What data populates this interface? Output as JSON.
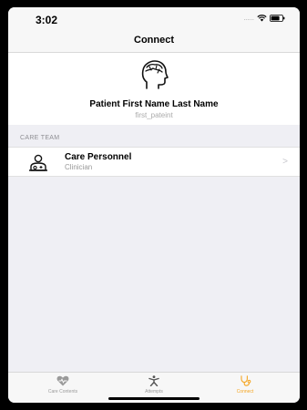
{
  "status_bar": {
    "time": "3:02",
    "signal": "......"
  },
  "nav": {
    "title": "Connect"
  },
  "profile": {
    "name": "Patient First Name Last Name",
    "username": "first_pateint",
    "avatar_icon": "head-brain-icon"
  },
  "care_team": {
    "section_label": "CARE TEAM",
    "items": [
      {
        "title": "Care Personnel",
        "subtitle": "Clinician",
        "icon": "clinician-icon",
        "chevron": ">"
      }
    ]
  },
  "tab_bar": {
    "tabs": [
      {
        "label": "Care Contents",
        "icon": "heart-icon",
        "active": false
      },
      {
        "label": "Attempts",
        "icon": "person-activity-icon",
        "active": false
      },
      {
        "label": "Connect",
        "icon": "stethoscope-icon",
        "active": true
      }
    ]
  },
  "colors": {
    "accent": "#f5a623",
    "background": "#efeff4",
    "inactive_tab": "#9a9a9a"
  }
}
